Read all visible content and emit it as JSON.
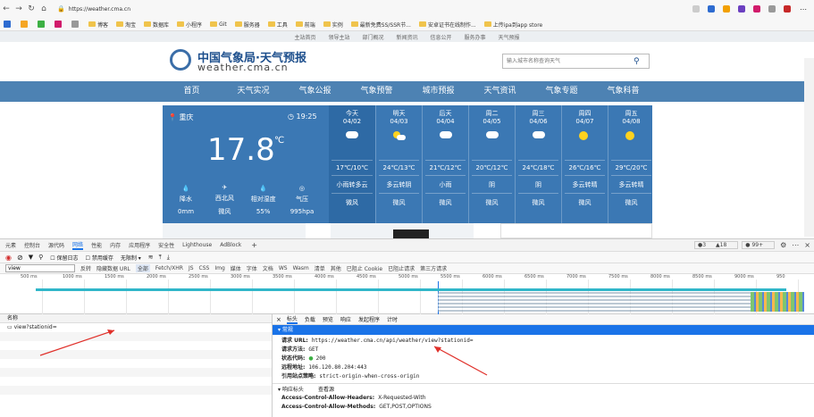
{
  "browser": {
    "url": "https://weather.cma.cn",
    "bookmarks": [
      "",
      "",
      "",
      "",
      "",
      "博客",
      "淘宝",
      "数据库",
      "小程序",
      "Git",
      "服务器",
      "工具",
      "前端",
      "实例",
      "最新免费SS/SSR节...",
      "安卓证书在线制作...",
      "上传ipa到app store"
    ],
    "address_icons": [
      "A",
      "☆",
      "↻"
    ]
  },
  "site": {
    "top_links": [
      "主站首页",
      "领导主站",
      "部门概况",
      "新闻资讯",
      "信息公开",
      "服务办事",
      "天气预报"
    ],
    "title": "中国气象局·天气预报",
    "domain": "weather.cma.cn",
    "search_placeholder": "输入城市名称查询天气",
    "nav": [
      "首页",
      "天气实况",
      "气象公报",
      "气象预警",
      "城市预报",
      "天气资讯",
      "气象专题",
      "气象科普"
    ],
    "current": {
      "city": "重庆",
      "time": "19:25",
      "temp": "17.8",
      "unit": "℃",
      "stats": [
        {
          "label": "降水",
          "value": "0mm"
        },
        {
          "label": "西北风",
          "value": "微风"
        },
        {
          "label": "相对湿度",
          "value": "55%"
        },
        {
          "label": "气压",
          "value": "995hpa"
        }
      ]
    },
    "forecast": [
      {
        "day": "今天",
        "date": "04/02",
        "temp": "17℃/10℃",
        "desc": "小雨转多云",
        "wind": "微风",
        "icon": "cloud"
      },
      {
        "day": "明天",
        "date": "04/03",
        "temp": "24℃/13℃",
        "desc": "多云转阴",
        "wind": "微风",
        "icon": "sun-cloud"
      },
      {
        "day": "后天",
        "date": "04/04",
        "temp": "21℃/12℃",
        "desc": "小雨",
        "wind": "微风",
        "icon": "cloud"
      },
      {
        "day": "周二",
        "date": "04/05",
        "temp": "20℃/12℃",
        "desc": "阴",
        "wind": "微风",
        "icon": "cloud"
      },
      {
        "day": "周三",
        "date": "04/06",
        "temp": "24℃/18℃",
        "desc": "阴",
        "wind": "微风",
        "icon": "cloud"
      },
      {
        "day": "周四",
        "date": "04/07",
        "temp": "26℃/16℃",
        "desc": "多云转晴",
        "wind": "微风",
        "icon": "sun"
      },
      {
        "day": "周五",
        "date": "04/08",
        "temp": "29℃/20℃",
        "desc": "多云转晴",
        "wind": "微风",
        "icon": "sun"
      }
    ]
  },
  "devtools": {
    "tabs": [
      "元素",
      "控制台",
      "源代码",
      "网络",
      "性能",
      "内存",
      "应用程序",
      "安全性",
      "Lighthouse",
      "AdBlock"
    ],
    "active_tab": "网络",
    "toolbar": [
      "保留日志",
      "禁用缓存",
      "无限制"
    ],
    "filter_value": "view",
    "filter_options": [
      "反转",
      "隐藏数据 URL",
      "全部",
      "Fetch/XHR",
      "JS",
      "CSS",
      "Img",
      "媒体",
      "字体",
      "文档",
      "WS",
      "Wasm",
      "清单",
      "其他",
      "已阻止 Cookie",
      "已阻止请求",
      "第三方请求"
    ],
    "badges": [
      "3",
      "18",
      "99+"
    ],
    "timeline_ticks": [
      "500 ms",
      "1000 ms",
      "1500 ms",
      "2000 ms",
      "2500 ms",
      "3000 ms",
      "3500 ms",
      "4000 ms",
      "4500 ms",
      "5000 ms",
      "5500 ms",
      "6000 ms",
      "6500 ms",
      "7000 ms",
      "7500 ms",
      "8000 ms",
      "8500 ms",
      "9000 ms",
      "950"
    ],
    "list_header": "名称",
    "request_name": "view?stationid=",
    "detail_tabs": [
      "标头",
      "负载",
      "预览",
      "响应",
      "发起程序",
      "计时"
    ],
    "general_title": "常规",
    "general": [
      {
        "k": "请求 URL:",
        "v": "https://weather.cma.cn/api/weather/view?stationid="
      },
      {
        "k": "请求方法:",
        "v": "GET"
      },
      {
        "k": "状态代码:",
        "v": "200"
      },
      {
        "k": "远程地址:",
        "v": "106.120.80.204:443"
      },
      {
        "k": "引用站点策略:",
        "v": "strict-origin-when-cross-origin"
      }
    ],
    "response_headers_title": "响应标头",
    "view_source": "查看源",
    "response_headers": [
      {
        "k": "Access-Control-Allow-Headers:",
        "v": "X-Requested-With"
      },
      {
        "k": "Access-Control-Allow-Methods:",
        "v": "GET,POST,OPTIONS"
      }
    ],
    "close_glyph": "×"
  },
  "colors": {
    "nav": "#4d82b3",
    "weather_bg": "#3b78b4",
    "today_bg": "#2e6aa5",
    "arrow": "#e0302a"
  }
}
